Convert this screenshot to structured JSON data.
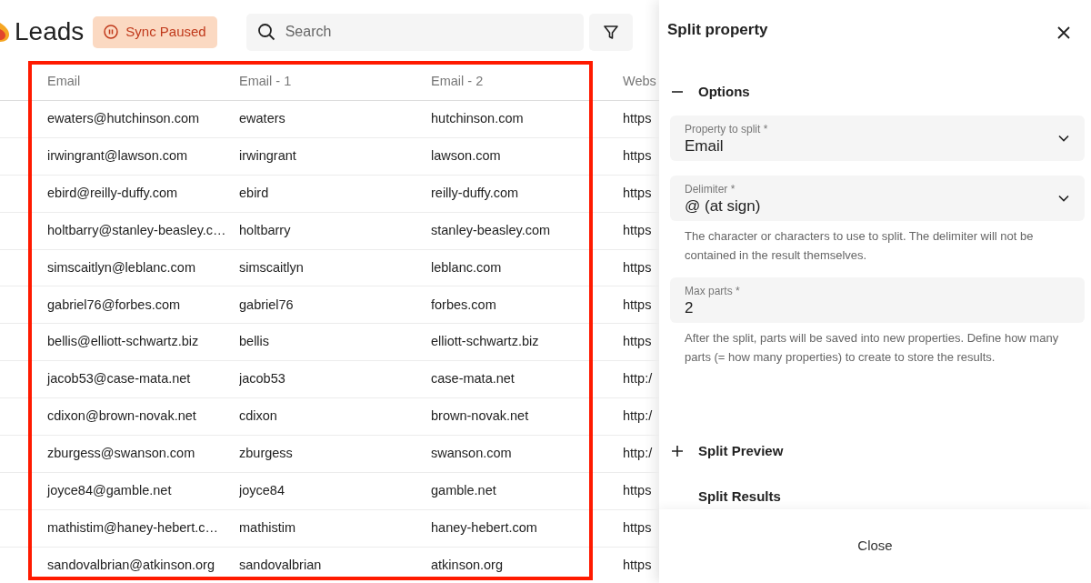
{
  "header": {
    "title": "Leads",
    "sync_badge": "Sync Paused",
    "search": {
      "placeholder": "Search"
    }
  },
  "table": {
    "columns": [
      "Email",
      "Email - 1",
      "Email - 2",
      "Webs"
    ],
    "rows": [
      [
        "ewaters@hutchinson.com",
        "ewaters",
        "hutchinson.com",
        "https"
      ],
      [
        "irwingrant@lawson.com",
        "irwingrant",
        "lawson.com",
        "https"
      ],
      [
        "ebird@reilly-duffy.com",
        "ebird",
        "reilly-duffy.com",
        "https"
      ],
      [
        "holtbarry@stanley-beasley.c…",
        "holtbarry",
        "stanley-beasley.com",
        "https"
      ],
      [
        "simscaitlyn@leblanc.com",
        "simscaitlyn",
        "leblanc.com",
        "https"
      ],
      [
        "gabriel76@forbes.com",
        "gabriel76",
        "forbes.com",
        "https"
      ],
      [
        "bellis@elliott-schwartz.biz",
        "bellis",
        "elliott-schwartz.biz",
        "https"
      ],
      [
        "jacob53@case-mata.net",
        "jacob53",
        "case-mata.net",
        "http:/"
      ],
      [
        "cdixon@brown-novak.net",
        "cdixon",
        "brown-novak.net",
        "http:/"
      ],
      [
        "zburgess@swanson.com",
        "zburgess",
        "swanson.com",
        "http:/"
      ],
      [
        "joyce84@gamble.net",
        "joyce84",
        "gamble.net",
        "https"
      ],
      [
        "mathistim@haney-hebert.c…",
        "mathistim",
        "haney-hebert.com",
        "https"
      ],
      [
        "sandovalbrian@atkinson.org",
        "sandovalbrian",
        "atkinson.org",
        "https"
      ]
    ]
  },
  "drawer": {
    "title": "Split property",
    "sections": [
      {
        "label": "Options",
        "expanded": true,
        "fields": [
          {
            "kind": "select",
            "label": "Property to split *",
            "value": "Email"
          },
          {
            "kind": "select",
            "label": "Delimiter *",
            "value": "@ (at sign)",
            "help": "The character or characters to use to split. The delimiter will not be contained in the result themselves."
          },
          {
            "kind": "number",
            "label": "Max parts *",
            "value": "2",
            "help": "After the split, parts will be saved into new properties. Define how many parts (= how many properties) to create to store the results."
          }
        ]
      },
      {
        "label": "Split Preview",
        "expanded": false
      },
      {
        "label": "Split Results"
      }
    ],
    "footer_button": "Close"
  }
}
